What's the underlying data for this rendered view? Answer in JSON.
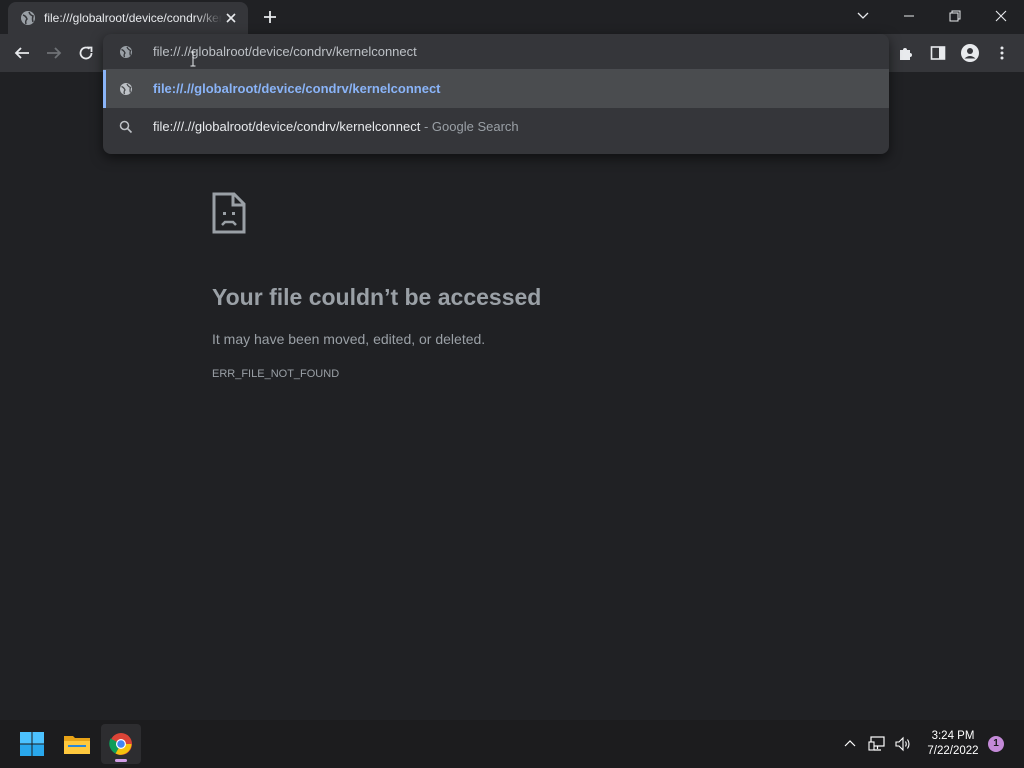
{
  "tab": {
    "title": "file:///globalroot/device/condrv/kernelconnect",
    "favicon": "globe-icon"
  },
  "omnibox": {
    "input_value": "file://.//globalroot/device/condrv/kernelconnect",
    "suggestions": [
      {
        "text": "file://.//globalroot/device/condrv/kernelconnect",
        "suffix": "",
        "icon": "globe-icon",
        "selected": true
      },
      {
        "text": "file:///.//globalroot/device/condrv/kernelconnect",
        "suffix": " - Google Search",
        "icon": "search-icon",
        "selected": false
      }
    ]
  },
  "error": {
    "title": "Your file couldn’t be accessed",
    "description": "It may have been moved, edited, or deleted.",
    "code": "ERR_FILE_NOT_FOUND",
    "icon": "sad-file-icon"
  },
  "taskbar": {
    "apps": [
      "start-icon",
      "file-explorer-icon",
      "chrome-icon"
    ],
    "clock_time": "3:24 PM",
    "clock_date": "7/22/2022",
    "notification_count": "1"
  },
  "colors": {
    "page_bg": "#202124",
    "toolbar_bg": "#35363a",
    "link_blue": "#8ab4f8",
    "muted_text": "#9aa0a6"
  }
}
